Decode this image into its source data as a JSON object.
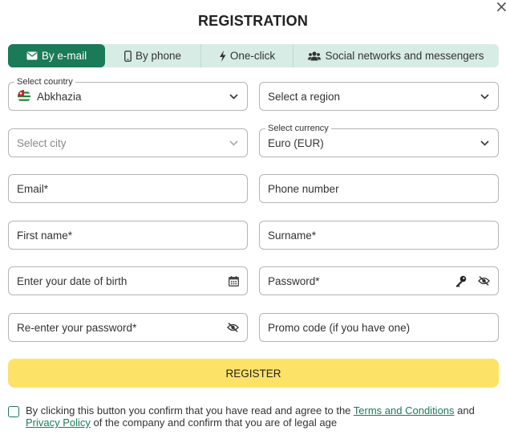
{
  "dialog": {
    "title": "REGISTRATION",
    "close_icon": "×"
  },
  "tabs": [
    {
      "label": "By e-mail",
      "icon": "envelope-icon",
      "active": true
    },
    {
      "label": "By phone",
      "icon": "phone-icon",
      "active": false
    },
    {
      "label": "One-click",
      "icon": "lightning-icon",
      "active": false
    },
    {
      "label": "Social networks and messengers",
      "icon": "users-icon",
      "active": false
    }
  ],
  "form": {
    "country": {
      "label": "Select country",
      "value": "Abkhazia"
    },
    "region": {
      "placeholder": "Select a region"
    },
    "city": {
      "placeholder": "Select city"
    },
    "currency": {
      "label": "Select currency",
      "value": "Euro (EUR)"
    },
    "email": {
      "placeholder": "Email*"
    },
    "phone": {
      "placeholder": "Phone number"
    },
    "first_name": {
      "placeholder": "First name*"
    },
    "surname": {
      "placeholder": "Surname*"
    },
    "dob": {
      "placeholder": "Enter your date of birth"
    },
    "password": {
      "placeholder": "Password*"
    },
    "password_repeat": {
      "placeholder": "Re-enter your password*"
    },
    "promo": {
      "placeholder": "Promo code (if you have one)"
    }
  },
  "register_label": "REGISTER",
  "agreement": {
    "text_before": "By clicking this button you confirm that you have read and agree to the ",
    "terms_link": "Terms and Conditions",
    "text_and": " and ",
    "privacy_link": "Privacy Policy",
    "text_after": " of the company and confirm that you are of legal age"
  },
  "colors": {
    "accent": "#1b7a57",
    "tab_bg": "#d7ece5",
    "button": "#fde268",
    "border": "#b5b5b5"
  }
}
